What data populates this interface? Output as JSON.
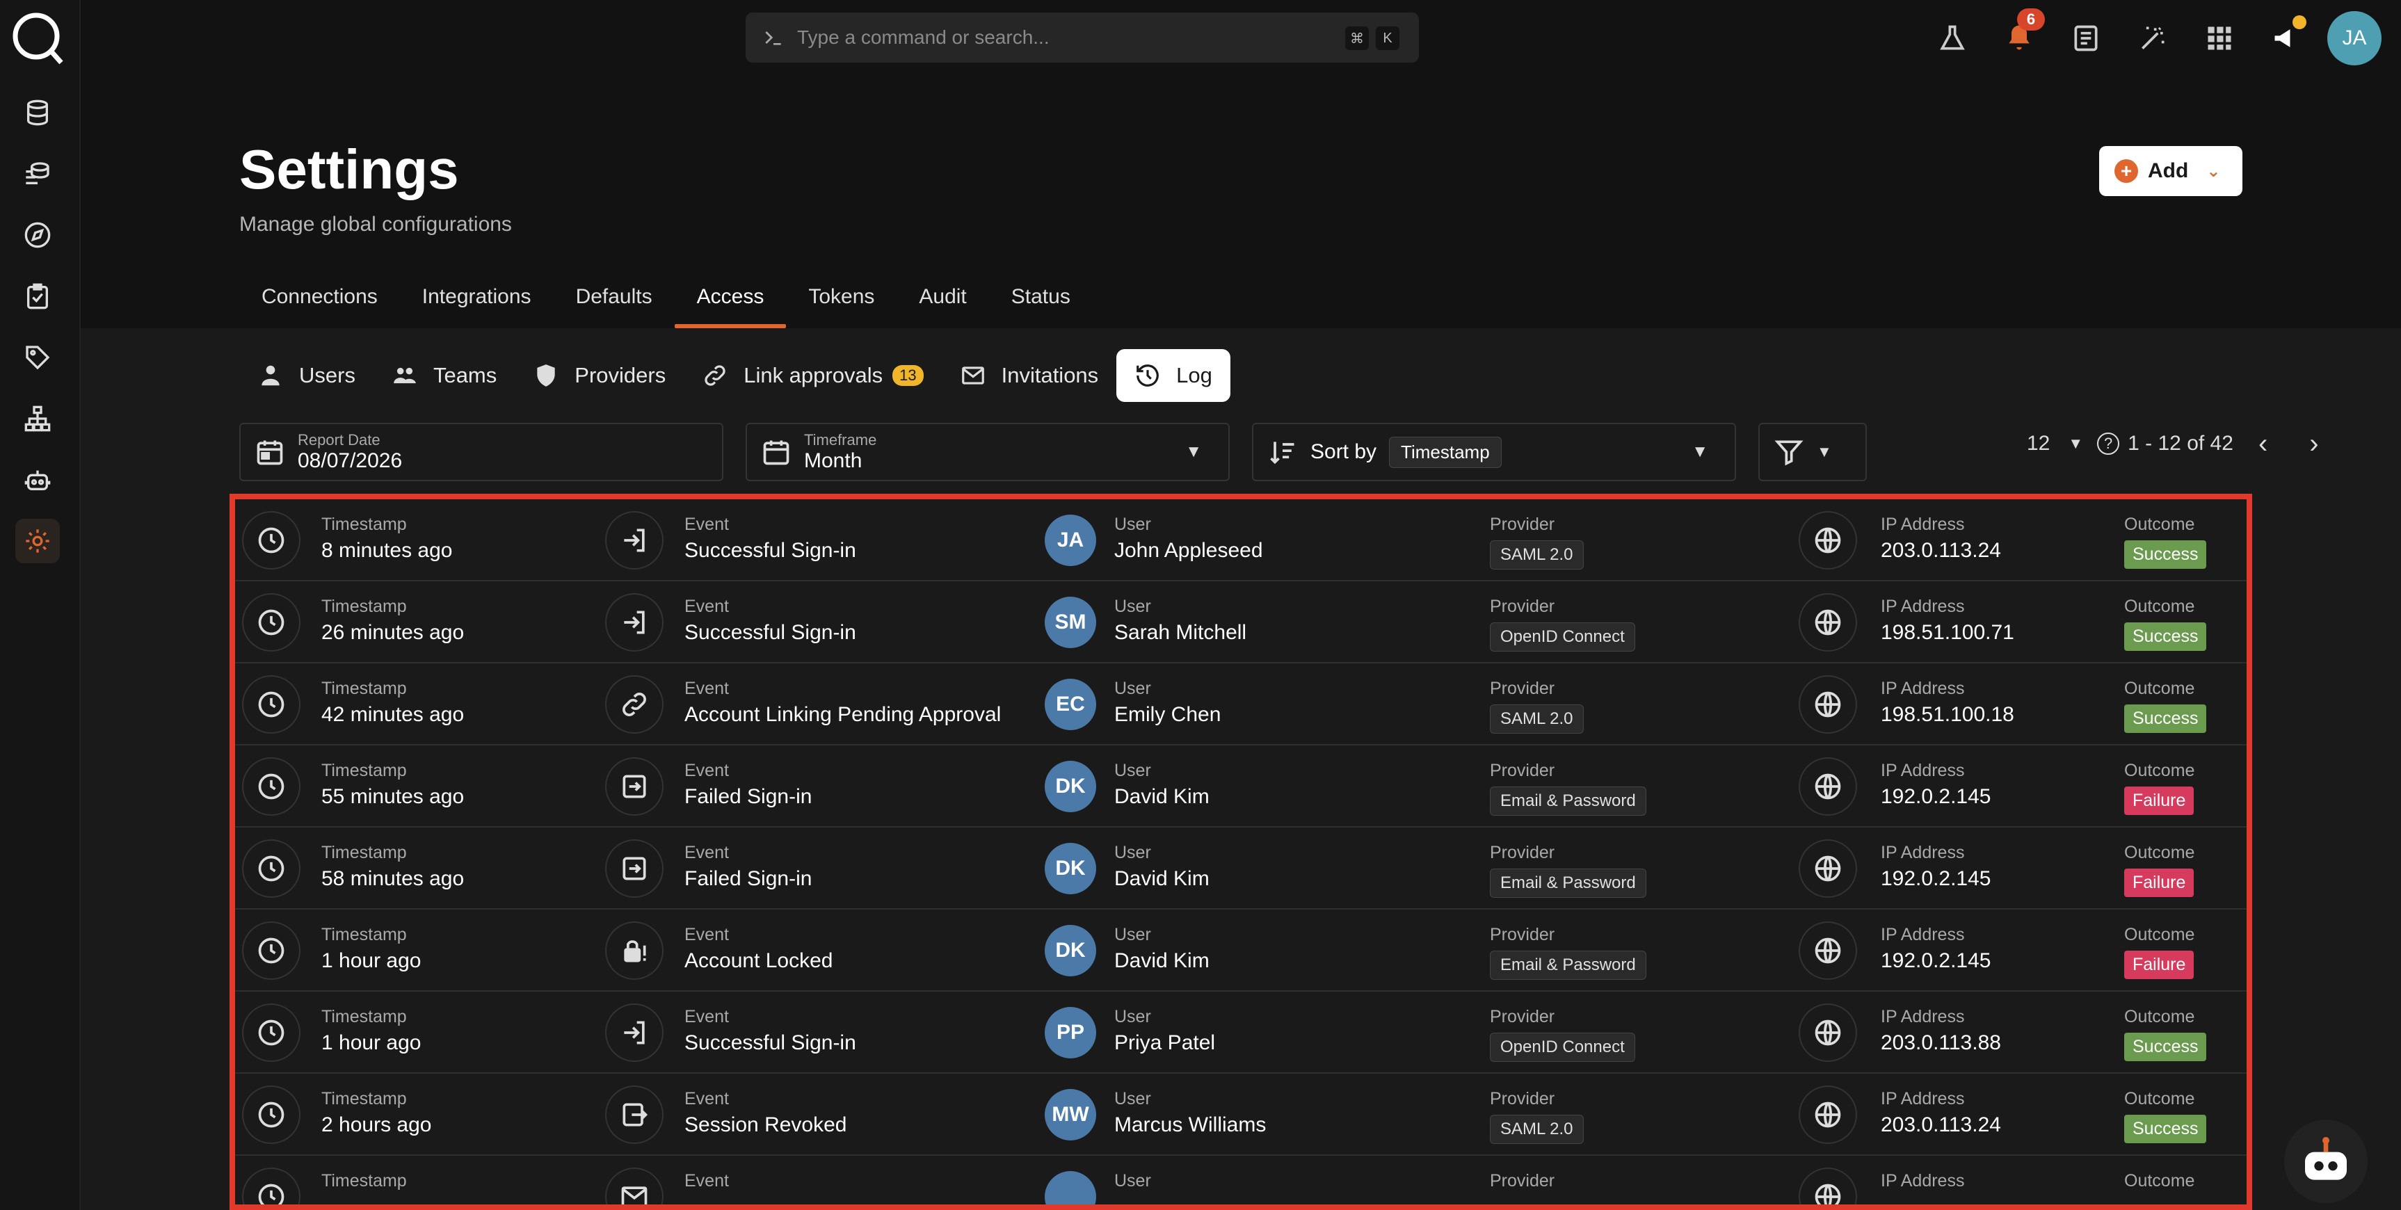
{
  "app": {
    "avatar_initials": "JA",
    "notifications_count": "6"
  },
  "search": {
    "placeholder": "Type a command or search...",
    "shortcut_key1": "⌘",
    "shortcut_key2": "K"
  },
  "page": {
    "title": "Settings",
    "subtitle": "Manage global configurations",
    "add_label": "Add"
  },
  "tabs": [
    "Connections",
    "Integrations",
    "Defaults",
    "Access",
    "Tokens",
    "Audit",
    "Status"
  ],
  "active_tab": "Access",
  "subtabs": {
    "users": "Users",
    "teams": "Teams",
    "providers": "Providers",
    "link_approvals": "Link approvals",
    "link_approvals_count": "13",
    "invitations": "Invitations",
    "log": "Log"
  },
  "filters": {
    "report_date_label": "Report Date",
    "report_date": "08/07/2026",
    "timeframe_label": "Timeframe",
    "timeframe": "Month",
    "sort_label": "Sort by",
    "sort_value": "Timestamp"
  },
  "pagination": {
    "page_size": "12",
    "range": "1 - 12 of 42"
  },
  "labels": {
    "timestamp": "Timestamp",
    "event": "Event",
    "user": "User",
    "provider": "Provider",
    "ip": "IP Address",
    "outcome": "Outcome"
  },
  "colors": {
    "accent": "#e0662f",
    "success": "#6a9b4e",
    "failure": "#d63b5e",
    "highlight": "#e23a2a"
  },
  "rows": [
    {
      "timestamp": "8 minutes ago",
      "event": "Successful Sign-in",
      "event_icon": "sign-in-icon",
      "initials": "JA",
      "user": "John Appleseed",
      "provider": "SAML 2.0",
      "ip": "203.0.113.24",
      "outcome": "Success"
    },
    {
      "timestamp": "26 minutes ago",
      "event": "Successful Sign-in",
      "event_icon": "sign-in-icon",
      "initials": "SM",
      "user": "Sarah Mitchell",
      "provider": "OpenID Connect",
      "ip": "198.51.100.71",
      "outcome": "Success"
    },
    {
      "timestamp": "42 minutes ago",
      "event": "Account Linking Pending Approval",
      "event_icon": "link-icon",
      "initials": "EC",
      "user": "Emily Chen",
      "provider": "SAML 2.0",
      "ip": "198.51.100.18",
      "outcome": "Success"
    },
    {
      "timestamp": "55 minutes ago",
      "event": "Failed Sign-in",
      "event_icon": "sign-in-failed-icon",
      "initials": "DK",
      "user": "David Kim",
      "provider": "Email & Password",
      "ip": "192.0.2.145",
      "outcome": "Failure"
    },
    {
      "timestamp": "58 minutes ago",
      "event": "Failed Sign-in",
      "event_icon": "sign-in-failed-icon",
      "initials": "DK",
      "user": "David Kim",
      "provider": "Email & Password",
      "ip": "192.0.2.145",
      "outcome": "Failure"
    },
    {
      "timestamp": "1 hour ago",
      "event": "Account Locked",
      "event_icon": "lock-icon",
      "initials": "DK",
      "user": "David Kim",
      "provider": "Email & Password",
      "ip": "192.0.2.145",
      "outcome": "Failure"
    },
    {
      "timestamp": "1 hour ago",
      "event": "Successful Sign-in",
      "event_icon": "sign-in-icon",
      "initials": "PP",
      "user": "Priya Patel",
      "provider": "OpenID Connect",
      "ip": "203.0.113.88",
      "outcome": "Success"
    },
    {
      "timestamp": "2 hours ago",
      "event": "Session Revoked",
      "event_icon": "session-revoked-icon",
      "initials": "MW",
      "user": "Marcus Williams",
      "provider": "SAML 2.0",
      "ip": "203.0.113.24",
      "outcome": "Success"
    },
    {
      "timestamp": "",
      "event": "",
      "event_icon": "mail-icon",
      "initials": "",
      "user": "",
      "provider": "",
      "ip": "",
      "outcome": ""
    }
  ]
}
